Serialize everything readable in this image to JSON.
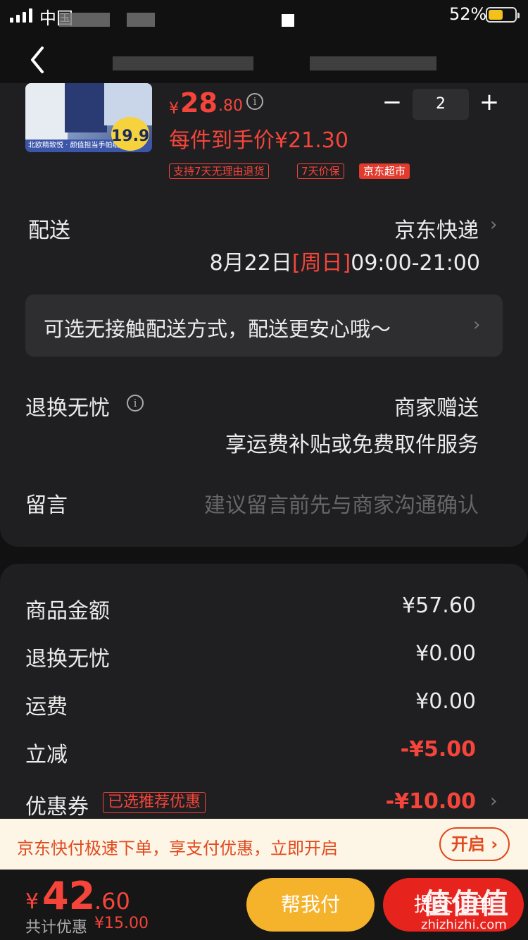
{
  "status_bar": {
    "carrier": "中国",
    "battery_text": "52%"
  },
  "product": {
    "price_symbol": "¥",
    "price_int": "28",
    "price_dec": ".80",
    "unit_price_text": "每件到手价¥21.30",
    "quantity": "2",
    "thumb_strip": "北欧精致悦 · 颜值担当手帕纸",
    "thumb_badge": "19.9",
    "tags": [
      "支持7天无理由退货",
      "7天价保",
      "京东超市"
    ]
  },
  "delivery": {
    "label": "配送",
    "carrier": "京东快递",
    "date": "8月22日",
    "weekday": "[周日]",
    "time": "09:00-21:00"
  },
  "contactless": {
    "text": "可选无接触配送方式，配送更安心哦～"
  },
  "return_service": {
    "label": "退换无忧",
    "value": "商家赠送",
    "sub": "享运费补贴或免费取件服务"
  },
  "message": {
    "label": "留言",
    "placeholder": "建议留言前先与商家沟通确认"
  },
  "summary": {
    "rows": [
      {
        "label": "商品金额",
        "value": "¥57.60"
      },
      {
        "label": "退换无忧",
        "value": "¥0.00"
      },
      {
        "label": "运费",
        "value": "¥0.00"
      },
      {
        "label": "立减",
        "value": "-¥5.00"
      },
      {
        "label": "优惠券",
        "value": "-¥10.00"
      }
    ],
    "coupon_tag": "已选推荐优惠"
  },
  "promo": {
    "text": "京东快付极速下单，享支付优惠，立即开启",
    "button": "开启 ›"
  },
  "footer": {
    "total_symbol": "¥",
    "total_int": "42",
    "total_dec": ".60",
    "saving_label": "共计优惠",
    "saving_value": "¥15.00",
    "pay_friend": "帮我付",
    "pay_now": "提交订单"
  },
  "watermark": {
    "text": "值值值",
    "url": "zhizhizhi.com"
  },
  "colors": {
    "accent_red": "#f5453b",
    "pay_friend": "#f5b32c",
    "pay_now": "#e7231d",
    "banner_bg": "#fdf5e6"
  }
}
